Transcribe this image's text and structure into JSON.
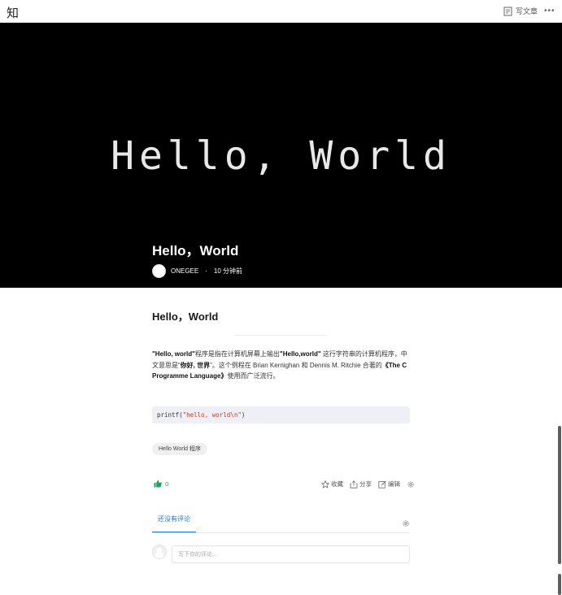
{
  "topbar": {
    "logo": "知",
    "write_label": "写文章",
    "more_label": "•••"
  },
  "hero": {
    "art_text": "Hello, World",
    "title": "Hello，World",
    "author": "ONEGEE",
    "separator": "·",
    "time": "10 分钟前"
  },
  "article": {
    "title": "Hello，World",
    "para": {
      "b1": "\"Hello, world\"",
      "t1": "程序是指在计算机屏幕上输出",
      "b2": "\"Hello,world\"",
      "t2": " 这行字符串的计算机程序，中文意思是“",
      "b3": "你好, 世界",
      "t3": "”。这个例程在 Brian Kernighan 和 Dennis M. Ritchie 合著的",
      "b4": "《The C Programme Language》",
      "t4": "使用而广泛流行。"
    },
    "code": {
      "prefix": "printf(",
      "string": "\"hello, world\\n\"",
      "suffix": ")"
    },
    "tag": "Hello World 程序"
  },
  "actions": {
    "like_count": "0",
    "collect": "收藏",
    "share": "分享",
    "edit": "编辑"
  },
  "comments": {
    "tab_label": "还没有评论",
    "placeholder": "写下你的评论..."
  }
}
